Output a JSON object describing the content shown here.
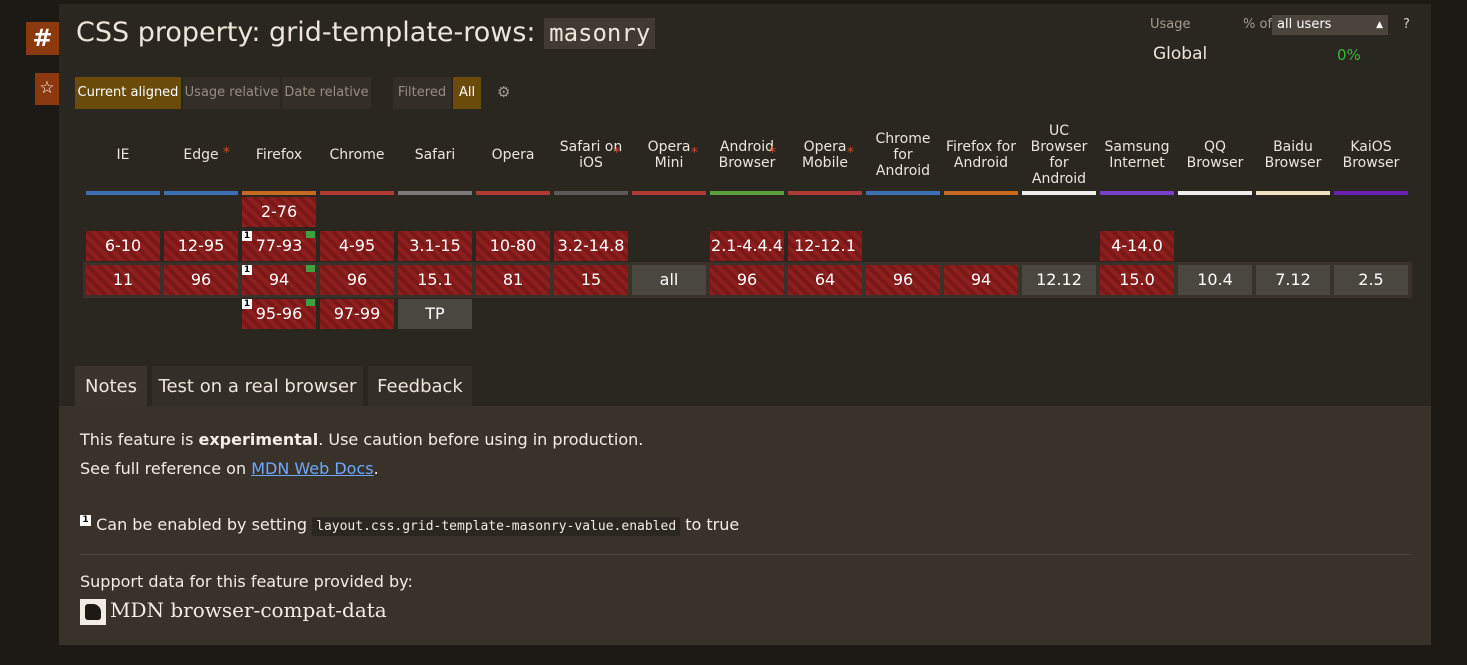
{
  "title": {
    "prefix": "CSS property: grid-template-rows:",
    "code": "masonry"
  },
  "usage": {
    "label": "Usage",
    "pct_of": "% of",
    "select": "all users",
    "help": "?",
    "region": "Global",
    "value": "0%"
  },
  "views": {
    "current": "Current aligned",
    "usage": "Usage relative",
    "date": "Date relative",
    "filtered": "Filtered",
    "all": "All"
  },
  "browsers": [
    {
      "name": "IE",
      "bar": "#3d6fb5",
      "asterisk": false,
      "earlier": [],
      "older": "6-10",
      "current": "11",
      "future": []
    },
    {
      "name": "Edge",
      "bar": "#3d6fb5",
      "asterisk": true,
      "earlier": [],
      "older": "12-95",
      "current": "96",
      "future": []
    },
    {
      "name": "Firefox",
      "bar": "#c56a1e",
      "asterisk": false,
      "earlier": [
        "2-76"
      ],
      "older": "77-93",
      "current": "94",
      "future": [
        "95-96"
      ]
    },
    {
      "name": "Chrome",
      "bar": "#ad3a37",
      "asterisk": false,
      "earlier": [],
      "older": "4-95",
      "current": "96",
      "future": [
        "97-99"
      ]
    },
    {
      "name": "Safari",
      "bar": "#7a7a7a",
      "asterisk": false,
      "earlier": [],
      "older": "3.1-15",
      "current": "15.1",
      "future": [
        "TP"
      ]
    },
    {
      "name": "Opera",
      "bar": "#ad3a37",
      "asterisk": false,
      "earlier": [],
      "older": "10-80",
      "current": "81",
      "future": []
    },
    {
      "name": "Safari on iOS",
      "bar": "#5a5a5a",
      "asterisk": true,
      "earlier": [],
      "older": "3.2-14.8",
      "current": "15",
      "future": []
    },
    {
      "name": "Opera Mini",
      "bar": "#ad3a37",
      "asterisk": true,
      "earlier": [],
      "older": "",
      "current": "all",
      "future": []
    },
    {
      "name": "Android Browser",
      "bar": "#5a9f3c",
      "asterisk": true,
      "earlier": [],
      "older": "2.1-4.4.4",
      "current": "96",
      "future": []
    },
    {
      "name": "Opera Mobile",
      "bar": "#ad3a37",
      "asterisk": true,
      "earlier": [],
      "older": "12-12.1",
      "current": "64",
      "future": []
    },
    {
      "name": "Chrome for Android",
      "bar": "#3d6fb5",
      "asterisk": false,
      "earlier": [],
      "older": "",
      "current": "96",
      "future": []
    },
    {
      "name": "Firefox for Android",
      "bar": "#c56a1e",
      "asterisk": false,
      "earlier": [],
      "older": "",
      "current": "94",
      "future": []
    },
    {
      "name": "UC Browser for Android",
      "bar": "#eeeeee",
      "asterisk": false,
      "earlier": [],
      "older": "",
      "current": "12.12",
      "future": []
    },
    {
      "name": "Samsung Internet",
      "bar": "#7b3fc7",
      "asterisk": false,
      "earlier": [],
      "older": "4-14.0",
      "current": "15.0",
      "future": []
    },
    {
      "name": "QQ Browser",
      "bar": "#eeeeee",
      "asterisk": false,
      "earlier": [],
      "older": "",
      "current": "10.4",
      "future": []
    },
    {
      "name": "Baidu Browser",
      "bar": "#f0e2c0",
      "asterisk": false,
      "earlier": [],
      "older": "",
      "current": "7.12",
      "future": []
    },
    {
      "name": "KaiOS Browser",
      "bar": "#6a1fb0",
      "asterisk": false,
      "earlier": [],
      "older": "",
      "current": "2.5",
      "future": []
    }
  ],
  "tabs": {
    "notes": "Notes",
    "test": "Test on a real browser",
    "feedback": "Feedback"
  },
  "notes": {
    "line1_pre": "This feature is ",
    "line1_bold": "experimental",
    "line1_post": ". Use caution before using in production.",
    "line2_pre": "See full reference on ",
    "line2_link": "MDN Web Docs",
    "line2_post": ".",
    "fn_num": "1",
    "fn_pre": "Can be enabled by setting ",
    "fn_code": "layout.css.grid-template-masonry-value.enabled",
    "fn_post": " to true"
  },
  "support": {
    "label": "Support data for this feature provided by:",
    "source": "MDN browser-compat-data"
  }
}
